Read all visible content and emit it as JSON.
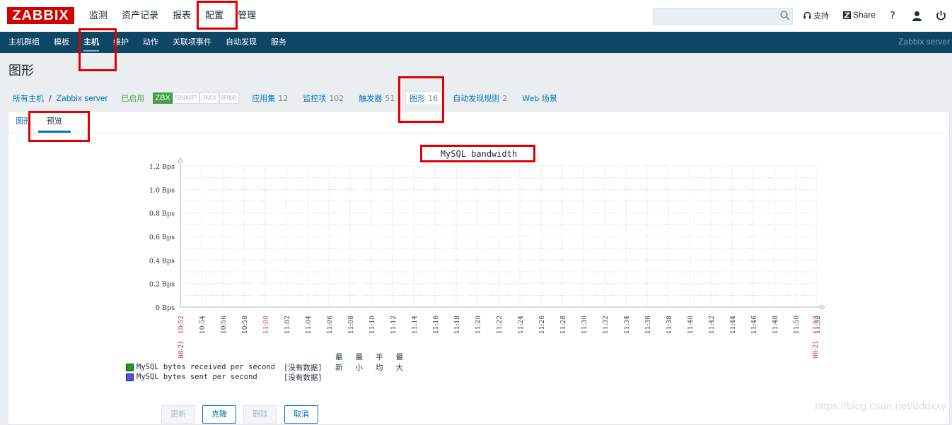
{
  "app": {
    "logo": "ZABBIX",
    "server_name": "Zabbix server"
  },
  "main_menu": [
    {
      "label": "监测"
    },
    {
      "label": "资产记录"
    },
    {
      "label": "报表"
    },
    {
      "label": "配置",
      "active": true
    },
    {
      "label": "管理"
    }
  ],
  "toolbar": {
    "search_placeholder": "",
    "support_label": "支持",
    "share_label": "Share",
    "help_label": "?"
  },
  "sub_menu": [
    {
      "label": "主机群组"
    },
    {
      "label": "模板"
    },
    {
      "label": "主机",
      "active": true
    },
    {
      "label": "维护"
    },
    {
      "label": "动作"
    },
    {
      "label": "关联项事件"
    },
    {
      "label": "自动发现"
    },
    {
      "label": "服务"
    }
  ],
  "page": {
    "title": "图形"
  },
  "breadcrumb": {
    "all_hosts": "所有主机",
    "separator": "/",
    "host": "Zabbix server",
    "status": "已启用",
    "availability": [
      {
        "label": "ZBX",
        "on": true
      },
      {
        "label": "SNMP",
        "on": false
      },
      {
        "label": "JMX",
        "on": false
      },
      {
        "label": "IPMI",
        "on": false
      }
    ],
    "items": [
      {
        "label": "应用集",
        "count": "12"
      },
      {
        "label": "监控项",
        "count": "102"
      },
      {
        "label": "触发器",
        "count": "51"
      },
      {
        "label": "图形",
        "count": "16",
        "current": true
      },
      {
        "label": "自动发现规则",
        "count": "2"
      },
      {
        "label": "Web 场景",
        "count": ""
      }
    ]
  },
  "tabs": [
    {
      "label": "图形"
    },
    {
      "label": "预览",
      "active": true
    }
  ],
  "chart_data": {
    "type": "line",
    "title": "MySQL bandwidth",
    "ylim": [
      0,
      1.2
    ],
    "y_ticks": [
      "1.2 Bps",
      "1.0 Bps",
      "0.8 Bps",
      "0.6 Bps",
      "0.4 Bps",
      "0.2 Bps",
      "0 Bps"
    ],
    "x_ticks": [
      "10:52",
      "10:54",
      "10:56",
      "10:58",
      "11:00",
      "11:02",
      "11:04",
      "11:06",
      "11:08",
      "11:10",
      "11:12",
      "11:14",
      "11:16",
      "11:18",
      "11:20",
      "11:22",
      "11:24",
      "11:26",
      "11:28",
      "11:30",
      "11:32",
      "11:34",
      "11:36",
      "11:38",
      "11:40",
      "11:42",
      "11:44",
      "11:46",
      "11:48",
      "11:50",
      "11:52",
      "11:52"
    ],
    "x_tick_highlight": [
      0,
      4,
      31
    ],
    "date_start": "08-21",
    "date_end": "08-21",
    "series": [
      {
        "name": "MySQL bytes received per second",
        "color": "#1a9b1a",
        "values": []
      },
      {
        "name": "MySQL bytes sent per second",
        "color": "#4b4bff",
        "values": []
      }
    ],
    "legend": {
      "headers": [
        "最新",
        "最小",
        "平均",
        "最大"
      ],
      "no_data": "[没有数据]"
    },
    "grid": true
  },
  "buttons": {
    "update": "更新",
    "clone": "克隆",
    "delete": "删除",
    "cancel": "取消"
  },
  "watermark": "https://blog.csdn.net/dddxxy"
}
